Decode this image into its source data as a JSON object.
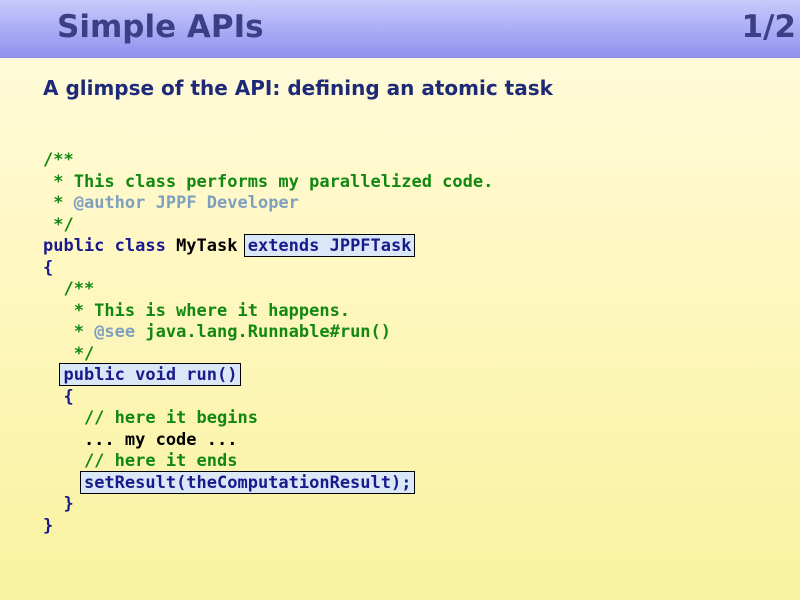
{
  "slide": {
    "title": "Simple APIs",
    "page": "1/2",
    "subtitle": "A glimpse of the API: defining an atomic task"
  },
  "code": {
    "l1": "/**",
    "l2": " * This class performs my parallelized code.",
    "l3_star": " * ",
    "l3_tag": "@author",
    "l3_text": " JPPF Developer",
    "l4": " */",
    "l5_kw": "public class",
    "l5_name": " MyTask ",
    "l5_ext": "extends JPPFTask",
    "l6": "{",
    "l7": "  /**",
    "l8": "   * This is where it happens.",
    "l9_star": "   * ",
    "l9_tag": "@see",
    "l9_text": " java.lang.Runnable#run()",
    "l10": "   */",
    "l11": "public void run()",
    "l12": "  {",
    "l13": "    // here it begins",
    "l14": "    ... my code ...",
    "l15": "    // here it ends",
    "l16": "setResult(theComputationResult);",
    "l17": "  }",
    "l18": "}"
  }
}
